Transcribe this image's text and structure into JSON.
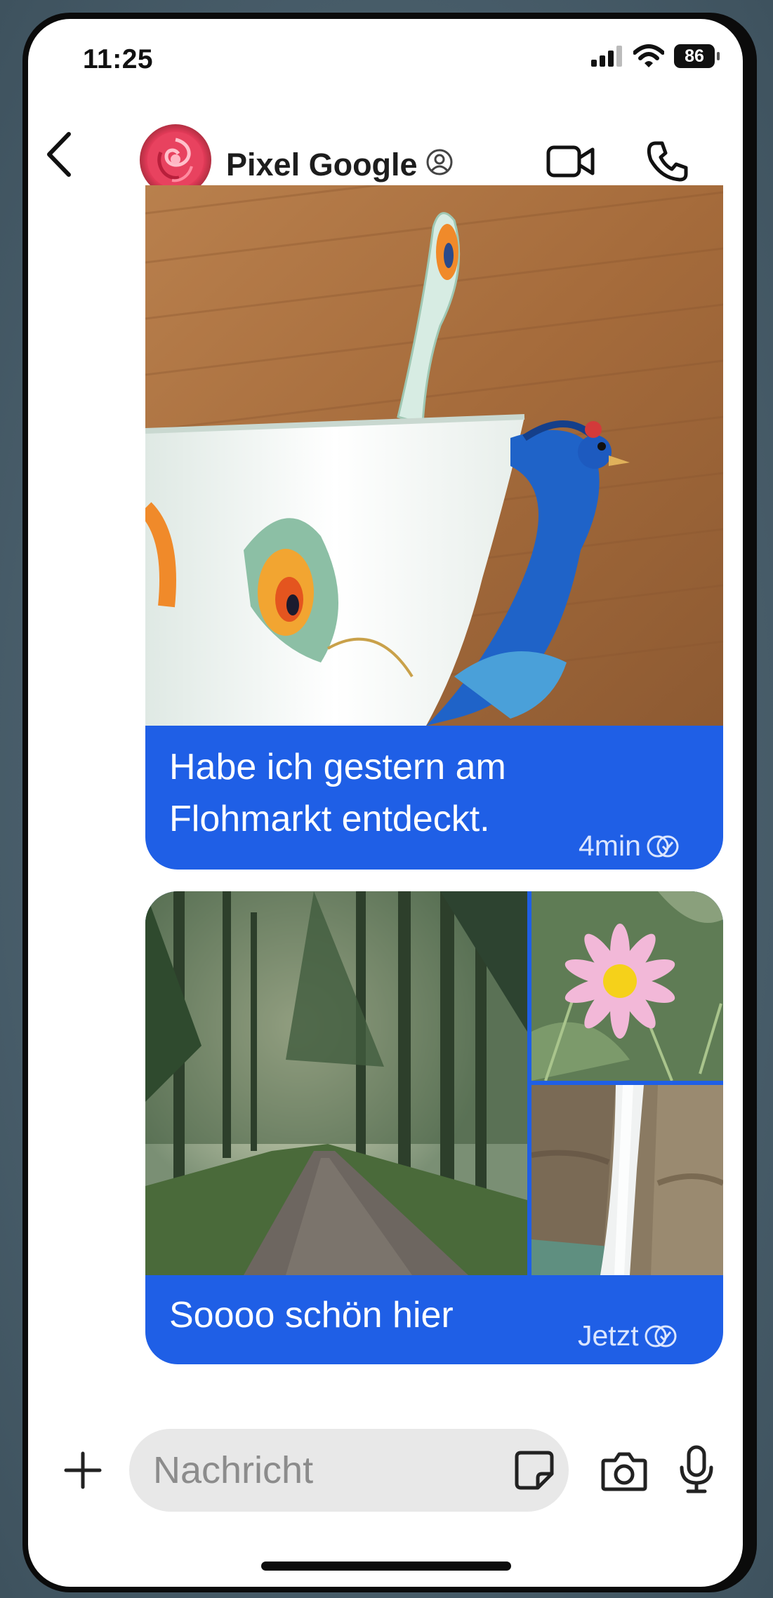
{
  "status_bar": {
    "time": "11:25",
    "battery": "86"
  },
  "header": {
    "contact_name": "Pixel Google"
  },
  "messages": [
    {
      "text_line1": "Habe ich gestern am",
      "text_line2": "Flohmarkt entdeckt.",
      "time": "4min"
    },
    {
      "text": "Soooo schön hier",
      "time": "Jetzt"
    }
  ],
  "composer": {
    "placeholder": "Nachricht"
  },
  "colors": {
    "bubble": "#1f5fe6",
    "background": "#ffffff",
    "input": "#e8e8e8"
  }
}
